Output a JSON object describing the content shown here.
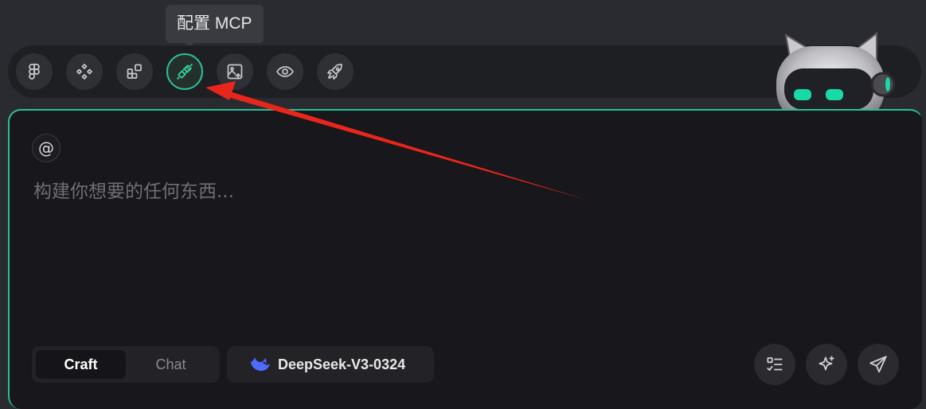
{
  "tooltip": {
    "text": "配置 MCP"
  },
  "toolbar": {
    "tools": [
      {
        "icon": "figma-icon"
      },
      {
        "icon": "components-icon"
      },
      {
        "icon": "blocks-icon"
      },
      {
        "icon": "plug-icon",
        "active": true
      },
      {
        "icon": "image-upload-icon"
      },
      {
        "icon": "eye-icon"
      },
      {
        "icon": "rocket-icon"
      }
    ]
  },
  "composer": {
    "mention_symbol": "@",
    "placeholder": "构建你想要的任何东西...",
    "modes": [
      {
        "label": "Craft",
        "selected": true
      },
      {
        "label": "Chat",
        "selected": false
      }
    ],
    "model": {
      "label": "DeepSeek-V3-0324",
      "icon": "deepseek-whale-icon"
    },
    "actions": [
      "task-list-icon",
      "sparkle-icon",
      "send-icon"
    ]
  },
  "colors": {
    "accent": "#2bbf94",
    "annotation_arrow": "#e8261b",
    "model_icon": "#4d6bfe"
  }
}
